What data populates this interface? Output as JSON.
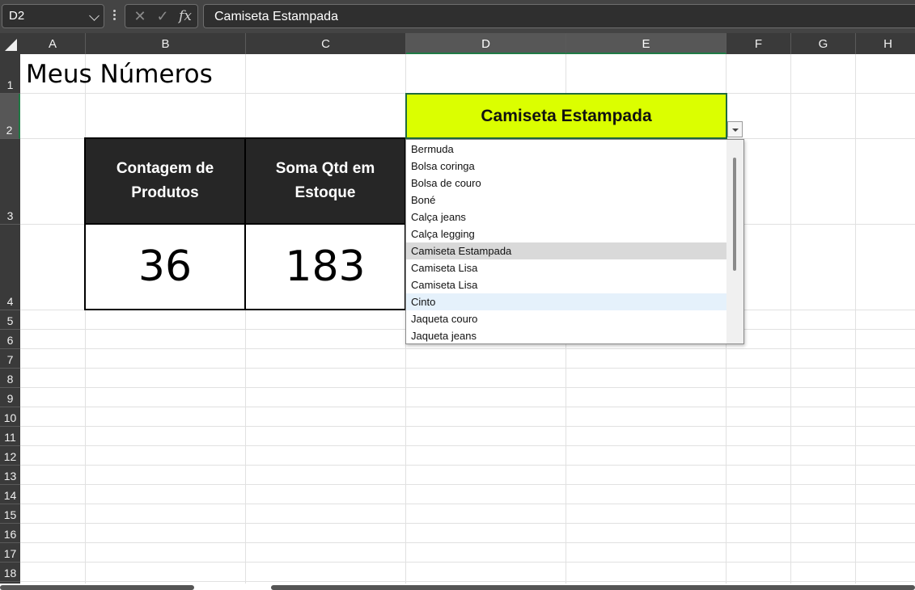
{
  "formula_bar": {
    "name_box": "D2",
    "cancel_glyph": "✕",
    "enter_glyph": "✓",
    "fx_label": "fx",
    "formula": "Camiseta Estampada"
  },
  "columns": [
    "A",
    "B",
    "C",
    "D",
    "E",
    "F",
    "G",
    "H"
  ],
  "rows": [
    "1",
    "2",
    "3",
    "4",
    "5",
    "6",
    "7",
    "8",
    "9",
    "10",
    "11",
    "12",
    "13",
    "14",
    "15",
    "16",
    "17",
    "18"
  ],
  "selected_cell": "D2",
  "sheet": {
    "title": "Meus Números",
    "header_count": "Contagem de Produtos",
    "header_sum": "Soma Qtd em Estoque",
    "value_count": "36",
    "value_sum": "183",
    "selected_value": "Camiseta Estampada",
    "highlight_color": "#DBFF00",
    "header_bg_color": "#262626"
  },
  "dropdown": {
    "items": [
      "Bermuda",
      "Bolsa coringa",
      "Bolsa de couro",
      "Boné",
      "Calça jeans",
      "Calça legging",
      "Camiseta Estampada",
      "Camiseta Lisa",
      "Camiseta Lisa",
      "Cinto",
      "Jaqueta couro",
      "Jaqueta jeans"
    ],
    "selected_index": 6,
    "hover_index": 9
  }
}
